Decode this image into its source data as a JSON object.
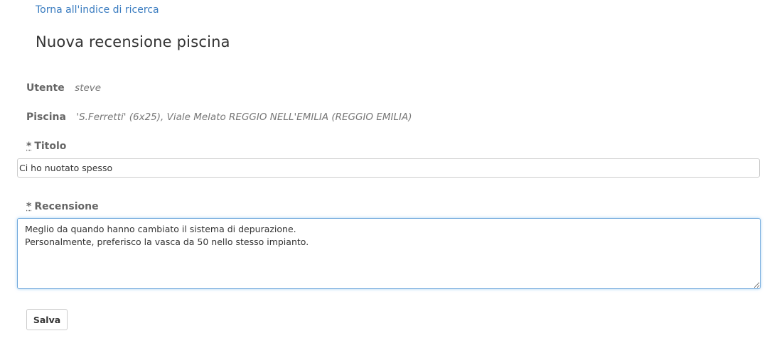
{
  "nav": {
    "back_link": "Torna all'indice di ricerca"
  },
  "page": {
    "title": "Nuova recensione piscina"
  },
  "info": {
    "user_label": "Utente",
    "user_value": "steve",
    "pool_label": "Piscina",
    "pool_value": "'S.Ferretti' (6x25), Viale Melato REGGIO NELL'EMILIA (REGGIO EMILIA)"
  },
  "form": {
    "required_mark": "*",
    "title_label": "Titolo",
    "title_value": "Ci ho nuotato spesso",
    "review_label": "Recensione",
    "review_value": "Meglio da quando hanno cambiato il sistema di depurazione.\nPersonalmente, preferisco la vasca da 50 nello stesso impianto.",
    "save_label": "Salva"
  },
  "colors": {
    "link": "#3a7cc0",
    "label": "#666666",
    "focus_border": "#6fa8dc"
  }
}
